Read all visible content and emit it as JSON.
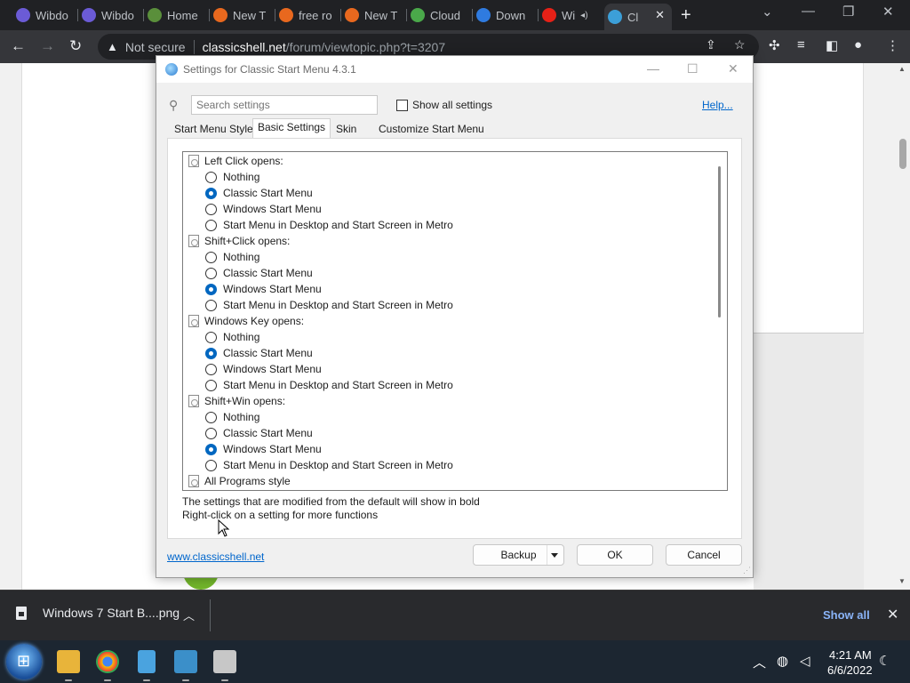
{
  "browser": {
    "tabs": [
      {
        "label": "Wibdo",
        "color": "#6b5bd6"
      },
      {
        "label": "Wibdo",
        "color": "#6b5bd6"
      },
      {
        "label": "Home",
        "color": "#5a8f3b"
      },
      {
        "label": "New T",
        "color": "#e8681e"
      },
      {
        "label": "free ro",
        "color": "#e8681e"
      },
      {
        "label": "New T",
        "color": "#e8681e"
      },
      {
        "label": "Cloud",
        "color": "#4aa84a"
      },
      {
        "label": "Down",
        "color": "#2f7be0"
      },
      {
        "label": "Wi",
        "color": "#e62117"
      },
      {
        "label": "Cl",
        "color": "#3c9fd8"
      }
    ],
    "address": {
      "security": "Not secure",
      "host": "classicshell.net",
      "path": "/forum/viewtopic.php?t=3207"
    }
  },
  "dialog": {
    "title": "Settings for Classic Start Menu 4.3.1",
    "search_placeholder": "Search settings",
    "show_all_label": "Show all settings",
    "help_label": "Help...",
    "tabs": [
      "Start Menu Style",
      "Basic Settings",
      "Skin",
      "Customize Start Menu"
    ],
    "groups": [
      {
        "label": "Left Click opens:",
        "options": [
          "Nothing",
          "Classic Start Menu",
          "Windows Start Menu",
          "Start Menu in Desktop and Start Screen in Metro"
        ],
        "selected": 1
      },
      {
        "label": "Shift+Click opens:",
        "options": [
          "Nothing",
          "Classic Start Menu",
          "Windows Start Menu",
          "Start Menu in Desktop and Start Screen in Metro"
        ],
        "selected": 2
      },
      {
        "label": "Windows Key opens:",
        "options": [
          "Nothing",
          "Classic Start Menu",
          "Windows Start Menu",
          "Start Menu in Desktop and Start Screen in Metro"
        ],
        "selected": 1
      },
      {
        "label": "Shift+Win opens:",
        "options": [
          "Nothing",
          "Classic Start Menu",
          "Windows Start Menu",
          "Start Menu in Desktop and Start Screen in Metro"
        ],
        "selected": 2
      },
      {
        "label": "All Programs style",
        "options": [],
        "selected": -1
      }
    ],
    "hint_line1": "The settings that are modified from the default will show in bold",
    "hint_line2": "Right-click on a setting for more functions",
    "site_link": "www.classicshell.net",
    "backup_label": "Backup",
    "ok_label": "OK",
    "cancel_label": "Cancel"
  },
  "downloads": {
    "file_name": "Windows 7 Start B....png",
    "show_all_label": "Show all"
  },
  "taskbar": {
    "time": "4:21 AM",
    "date": "6/6/2022"
  }
}
